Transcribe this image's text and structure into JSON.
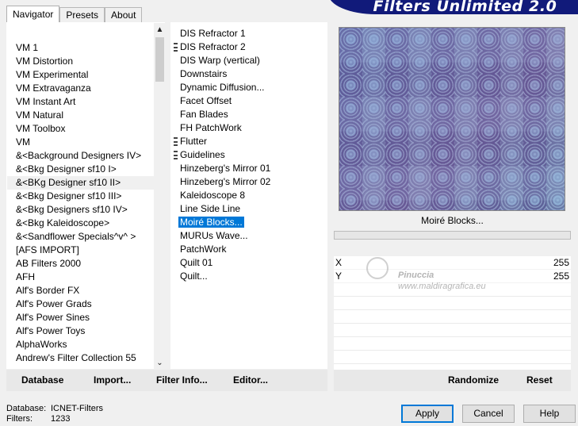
{
  "tabs": [
    {
      "label": "Navigator",
      "active": true
    },
    {
      "label": "Presets",
      "active": false
    },
    {
      "label": "About",
      "active": false
    }
  ],
  "banner": {
    "title": "Filters Unlimited 2.0"
  },
  "categories": [
    "VM 1",
    "VM Distortion",
    "VM Experimental",
    "VM Extravaganza",
    "VM Instant Art",
    "VM Natural",
    "VM Toolbox",
    "VM",
    "&<Background Designers IV>",
    "&<Bkg Designer sf10 I>",
    "&<BKg Designer sf10 II>",
    "&<Bkg Designer sf10 III>",
    "&<Bkg Designers sf10 IV>",
    "&<Bkg Kaleidoscope>",
    "&<Sandflower Specials^v^ >",
    "[AFS IMPORT]",
    "AB Filters 2000",
    "AFH",
    "Alf's Border FX",
    "Alf's Power Grads",
    "Alf's Power Sines",
    "Alf's Power Toys",
    "AlphaWorks",
    "Andrew's Filter Collection 55"
  ],
  "selected_category_index": 10,
  "filters": [
    {
      "label": "DIS Refractor 1",
      "grip": false
    },
    {
      "label": "DIS Refractor 2",
      "grip": true
    },
    {
      "label": "DIS Warp (vertical)",
      "grip": false
    },
    {
      "label": "Downstairs",
      "grip": false
    },
    {
      "label": "Dynamic Diffusion...",
      "grip": false
    },
    {
      "label": "Facet Offset",
      "grip": false
    },
    {
      "label": "Fan Blades",
      "grip": false
    },
    {
      "label": "FH PatchWork",
      "grip": false
    },
    {
      "label": "Flutter",
      "grip": true
    },
    {
      "label": "Guidelines",
      "grip": true
    },
    {
      "label": "Hinzeberg's Mirror 01",
      "grip": false
    },
    {
      "label": "Hinzeberg's Mirror 02",
      "grip": false
    },
    {
      "label": "Kaleidoscope 8",
      "grip": false
    },
    {
      "label": "Line Side Line",
      "grip": false
    },
    {
      "label": "Moiré Blocks...",
      "grip": false,
      "selected": true
    },
    {
      "label": "MURUs Wave...",
      "grip": false
    },
    {
      "label": "PatchWork",
      "grip": false
    },
    {
      "label": "Quilt 01",
      "grip": false
    },
    {
      "label": "Quilt...",
      "grip": false
    }
  ],
  "preview": {
    "filter_name": "Moiré Blocks..."
  },
  "params": [
    {
      "name": "X",
      "value": "255"
    },
    {
      "name": "Y",
      "value": "255"
    }
  ],
  "watermark": {
    "line1": "Pinuccia",
    "line2": "www.maldiragrafica.eu"
  },
  "left_buttons": [
    "Database",
    "Import...",
    "Filter Info...",
    "Editor..."
  ],
  "right_buttons": [
    "Randomize",
    "Reset"
  ],
  "info": {
    "database_label": "Database:",
    "database_value": "ICNET-Filters",
    "filters_label": "Filters:",
    "filters_value": "1233"
  },
  "dialog": {
    "apply": "Apply",
    "cancel": "Cancel",
    "help": "Help"
  },
  "colors": {
    "selection": "#0078d7",
    "banner": "#111a7a"
  }
}
